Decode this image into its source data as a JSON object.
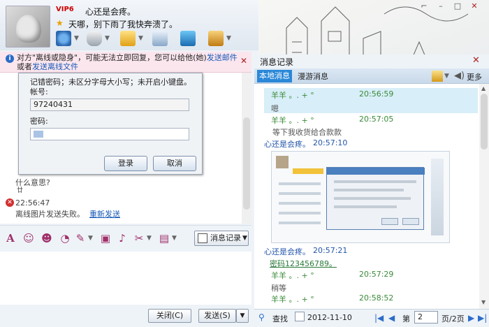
{
  "window": {
    "vip_badge": "VIP6",
    "nickname": "心还是会疼。",
    "status_message": "天哪，别下雨了我快奔溃了。"
  },
  "notice": {
    "text_prefix": "对方\"离线或隐身\"，可能无法立即回复，您可以给他(她)",
    "link_offline_mail": "发送邮件",
    "text_middle": "或者",
    "link_offline_file": "发送离线文件"
  },
  "login_dialog": {
    "partial_line": "记错密码；未区分字母大小写；未开启小键盘。",
    "account_label": "帐号:",
    "account_value": "97240431",
    "password_label": "密码:",
    "login_button": "登录",
    "cancel_button": "取消"
  },
  "chat": {
    "line_question": "什么意思?",
    "line_small": "廿",
    "time": "22:56:47",
    "failed_text": "离线图片发送失败。",
    "resend_link": "重新发送"
  },
  "input_toolbar": {
    "message_log_button": "消息记录"
  },
  "bottom": {
    "close_button": "关闭(C)",
    "send_button": "发送(S)"
  },
  "log_panel": {
    "title": "消息记录",
    "tab_local": "本地消息",
    "tab_roaming": "漫游消息",
    "more": "更多",
    "entries": [
      {
        "sender": "羊羊  。. + °",
        "time": "20:56:59",
        "text": "嗯"
      },
      {
        "sender": "羊羊  。. + °",
        "time": "20:57:05",
        "text": "等下我收货给合款款"
      },
      {
        "sender": "心还是会疼。",
        "time": "20:57:10",
        "text": ""
      },
      {
        "sender": "心还是会疼。",
        "time": "20:57:21",
        "text": "密码123456789。"
      },
      {
        "sender": "羊羊  。. + °",
        "time": "20:57:29",
        "text": "稍等"
      },
      {
        "sender": "羊羊  。. + °",
        "time": "20:58:52",
        "text": ""
      }
    ],
    "search": "查找",
    "date": "2012-11-10",
    "page_label": "第",
    "page_value": "2",
    "page_total": "页/2页"
  }
}
